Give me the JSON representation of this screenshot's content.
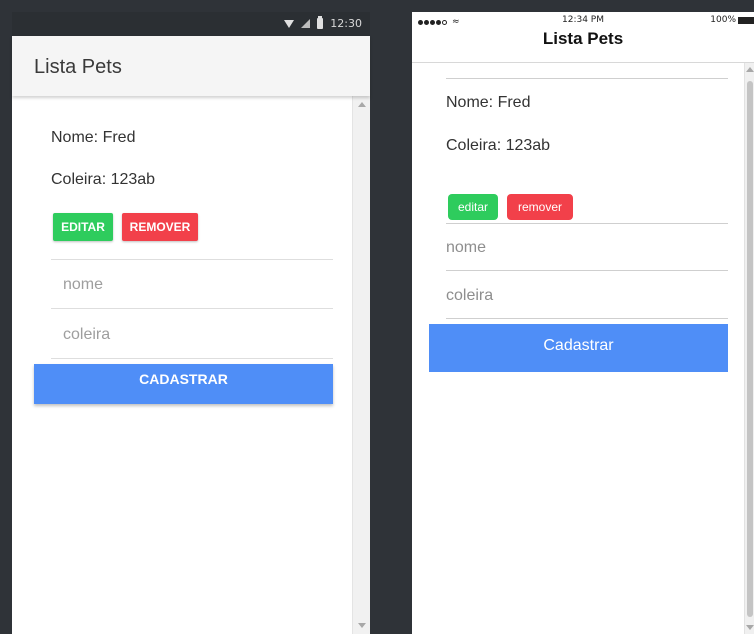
{
  "colors": {
    "device_frame": "#2f3338",
    "primary_blue": "#4f8ef7",
    "edit_green": "#2ecc5d",
    "remove_red": "#f2404a"
  },
  "android": {
    "status": {
      "time": "12:30",
      "icons": [
        "wifi-icon",
        "signal-icon",
        "battery-icon"
      ]
    },
    "toolbar": {
      "title": "Lista Pets"
    },
    "pet": {
      "nome_label": "Nome: Fred",
      "coleira_label": "Coleira: 123ab"
    },
    "buttons": {
      "edit": "EDITAR",
      "remove": "REMOVER"
    },
    "form": {
      "nome": {
        "value": "",
        "placeholder": "nome"
      },
      "coleira": {
        "value": "",
        "placeholder": "coleira"
      },
      "submit": "CADASTRAR"
    }
  },
  "ios": {
    "status": {
      "carrier": "●●●●○",
      "time": "12:34 PM",
      "battery": "100%",
      "icons": [
        "signal-dots-icon",
        "wifi-icon",
        "battery-icon"
      ]
    },
    "navbar": {
      "title": "Lista Pets"
    },
    "pet": {
      "nome_label": "Nome: Fred",
      "coleira_label": "Coleira: 123ab"
    },
    "buttons": {
      "edit": "editar",
      "remove": "remover"
    },
    "form": {
      "nome": {
        "value": "",
        "placeholder": "nome"
      },
      "coleira": {
        "value": "",
        "placeholder": "coleira"
      },
      "submit": "Cadastrar"
    }
  }
}
